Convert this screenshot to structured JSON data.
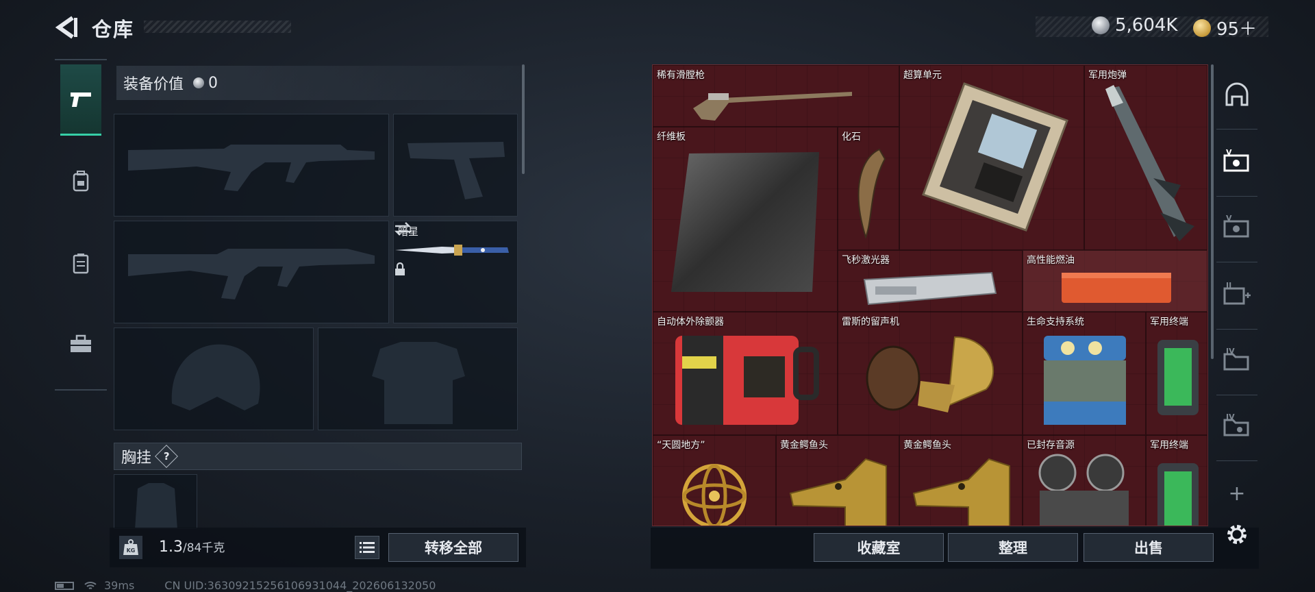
{
  "header": {
    "title": "仓库",
    "currency_silver": "5,604K",
    "currency_gold": "95＋"
  },
  "left_nav": {
    "items": [
      "firearms",
      "backpack",
      "armor-vest",
      "toolbox"
    ],
    "active": "firearms"
  },
  "loadout": {
    "equip_value_label": "装备价值",
    "equip_value": "0",
    "melee_label": "暗星",
    "chest_rig_label": "胸挂",
    "chest_rig_help": "?",
    "weight_current": "1.3",
    "weight_max": "/84千克",
    "weight_icon_text": "KG",
    "transfer_all": "转移全部"
  },
  "stash": {
    "items": [
      {
        "name": "稀有滑膛枪"
      },
      {
        "name": "超算单元"
      },
      {
        "name": "军用炮弹"
      },
      {
        "name": "纤维板"
      },
      {
        "name": "化石"
      },
      {
        "name": "飞秒激光器"
      },
      {
        "name": "高性能燃油"
      },
      {
        "name": "自动体外除颤器"
      },
      {
        "name": "雷斯的留声机"
      },
      {
        "name": "生命支持系统"
      },
      {
        "name": "军用终端"
      },
      {
        "name": "“天圆地方”"
      },
      {
        "name": "黄金鳄鱼头"
      },
      {
        "name": "黄金鳄鱼头"
      },
      {
        "name": "已封存音源"
      },
      {
        "name": "军用终端"
      }
    ],
    "actions": {
      "collection": "收藏室",
      "organize": "整理",
      "sell": "出售"
    }
  },
  "right_nav": {
    "tab_labels": [
      "V",
      "V",
      "II",
      "IV",
      "IV"
    ],
    "add": "+"
  },
  "status_bar": {
    "ping": "39ms",
    "uid": "CN UID:3630921525610693104​4_202606132050"
  }
}
